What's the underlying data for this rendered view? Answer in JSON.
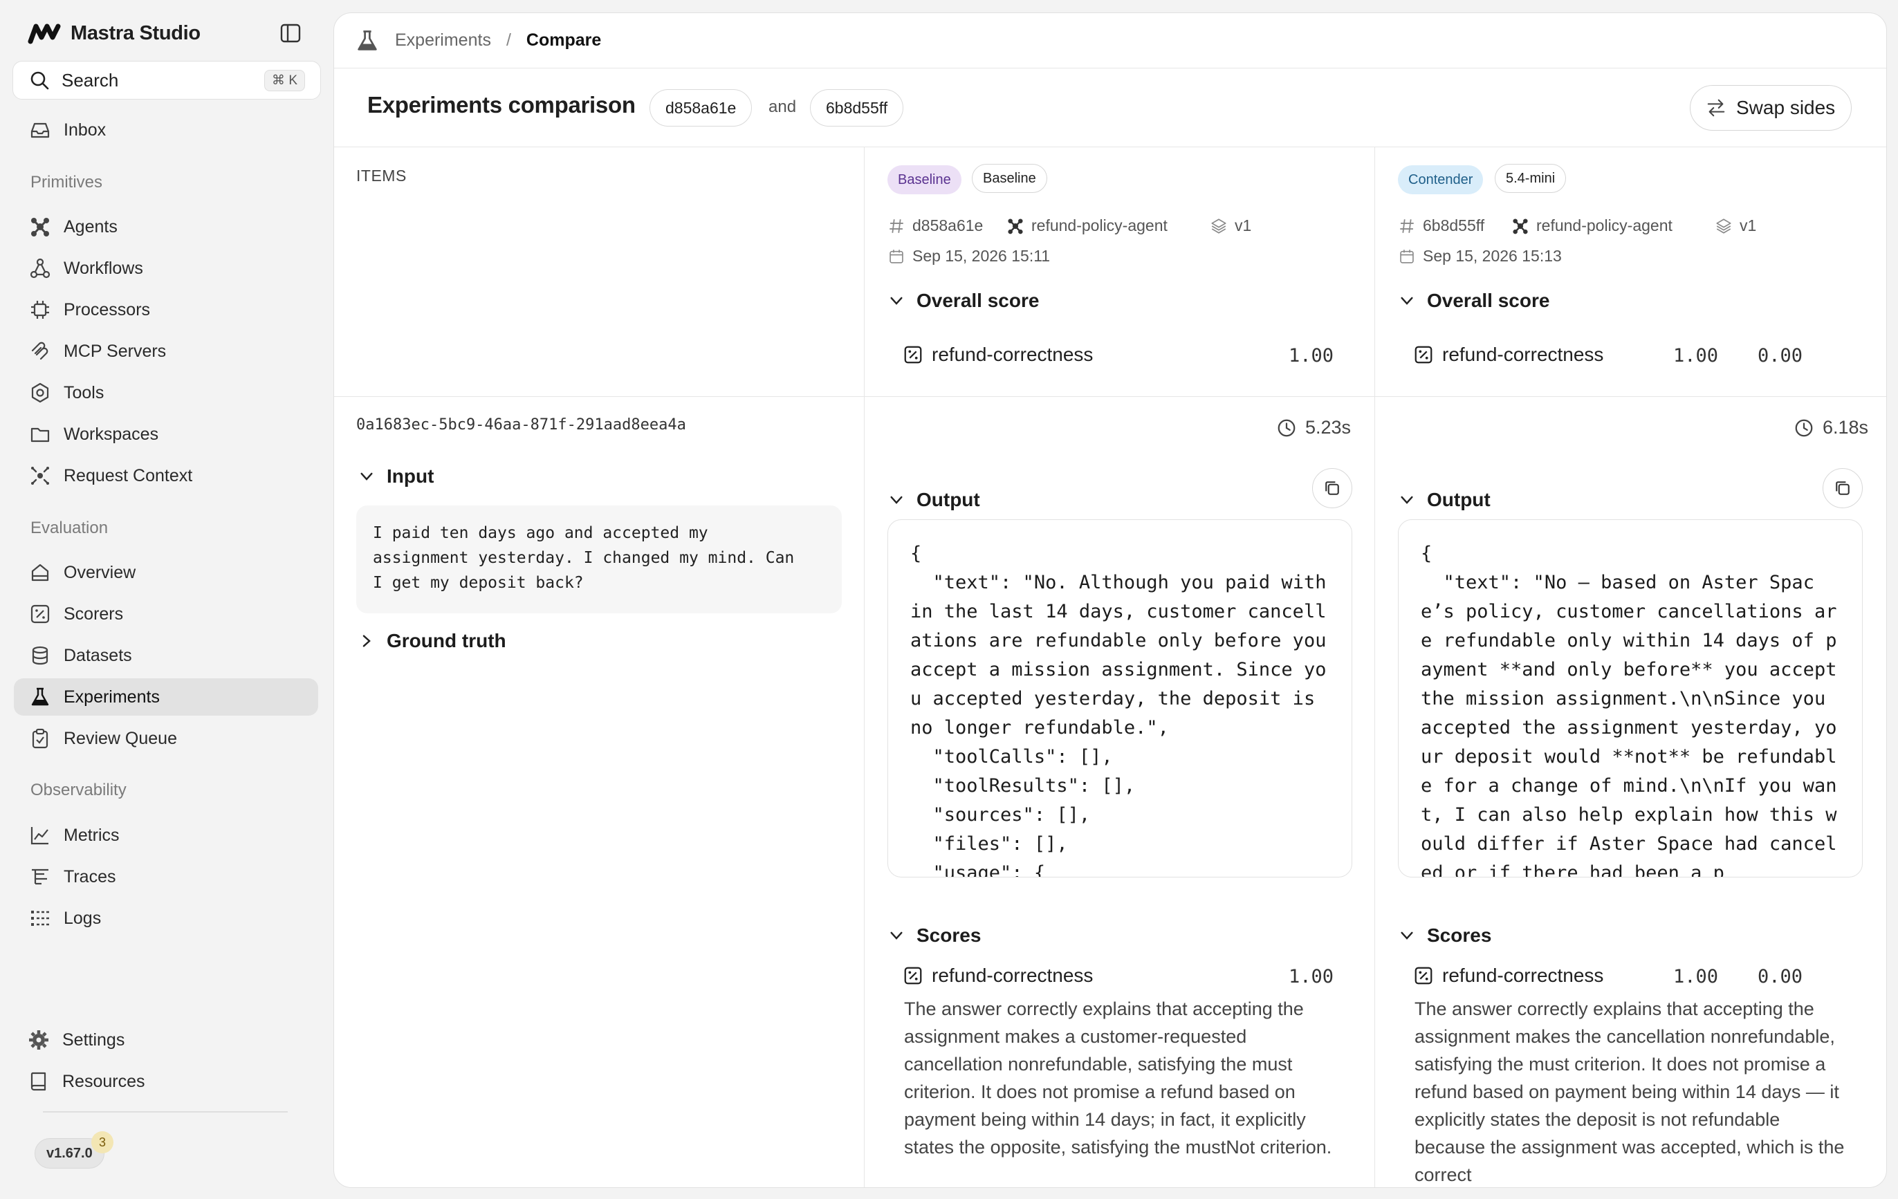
{
  "app": {
    "brand": "Mastra Studio",
    "search_label": "Search",
    "search_shortcut": "⌘ K",
    "version": "v1.67.0",
    "version_badge": "3"
  },
  "sidebar": {
    "top_items": [
      {
        "label": "Inbox",
        "icon": "inbox-icon"
      }
    ],
    "sections": [
      {
        "title": "Primitives",
        "items": [
          {
            "label": "Agents",
            "icon": "agents-icon"
          },
          {
            "label": "Workflows",
            "icon": "workflows-icon"
          },
          {
            "label": "Processors",
            "icon": "processors-icon"
          },
          {
            "label": "MCP Servers",
            "icon": "mcp-icon"
          },
          {
            "label": "Tools",
            "icon": "tools-icon"
          },
          {
            "label": "Workspaces",
            "icon": "folder-icon"
          },
          {
            "label": "Request Context",
            "icon": "request-context-icon"
          }
        ]
      },
      {
        "title": "Evaluation",
        "items": [
          {
            "label": "Overview",
            "icon": "home-icon"
          },
          {
            "label": "Scorers",
            "icon": "percent-icon"
          },
          {
            "label": "Datasets",
            "icon": "database-icon"
          },
          {
            "label": "Experiments",
            "icon": "flask-icon",
            "active": true
          },
          {
            "label": "Review Queue",
            "icon": "clipboard-icon"
          }
        ]
      },
      {
        "title": "Observability",
        "items": [
          {
            "label": "Metrics",
            "icon": "chart-icon"
          },
          {
            "label": "Traces",
            "icon": "traces-icon"
          },
          {
            "label": "Logs",
            "icon": "logs-icon"
          }
        ]
      }
    ],
    "bottom_items": [
      {
        "label": "Settings",
        "icon": "gear-icon"
      },
      {
        "label": "Resources",
        "icon": "book-icon"
      }
    ]
  },
  "breadcrumb": {
    "parent": "Experiments",
    "separator": "/",
    "current": "Compare"
  },
  "header": {
    "title": "Experiments comparison",
    "left_id": "d858a61e",
    "joiner": "and",
    "right_id": "6b8d55ff",
    "swap_label": "Swap sides"
  },
  "items_label": "ITEMS",
  "experiments": {
    "left": {
      "role_badge": "Baseline",
      "name_badge": "Baseline",
      "id": "d858a61e",
      "agent": "refund-policy-agent",
      "version": "v1",
      "date": "Sep 15, 2026 15:11",
      "overall_label": "Overall score",
      "overall_scorer": "refund-correctness",
      "overall_value": "1.00",
      "duration": "5.23s",
      "output_label": "Output",
      "output": "{\n  \"text\": \"No. Although you paid within the last 14 days, customer cancellations are refundable only before you accept a mission assignment. Since you accepted yesterday, the deposit is no longer refundable.\",\n  \"toolCalls\": [],\n  \"toolResults\": [],\n  \"sources\": [],\n  \"files\": [],\n  \"usage\": {",
      "scores_label": "Scores",
      "score_scorer": "refund-correctness",
      "score_value": "1.00",
      "reason": "The answer correctly explains that accepting the assignment makes a customer-requested cancellation nonrefundable, satisfying the must criterion. It does not promise a refund based on payment being within 14 days; in fact, it explicitly states the opposite, satisfying the mustNot criterion."
    },
    "right": {
      "role_badge": "Contender",
      "name_badge": "5.4-mini",
      "id": "6b8d55ff",
      "agent": "refund-policy-agent",
      "version": "v1",
      "date": "Sep 15, 2026 15:13",
      "overall_label": "Overall score",
      "overall_scorer": "refund-correctness",
      "overall_value": "1.00",
      "overall_delta": "0.00",
      "duration": "6.18s",
      "output_label": "Output",
      "output": "{\n  \"text\": \"No — based on Aster Space’s policy, customer cancellations are refundable only within 14 days of payment **and only before** you accept the mission assignment.\\n\\nSince you accepted the assignment yesterday, your deposit would **not** be refundable for a change of mind.\\n\\nIf you want, I can also help explain how this would differ if Aster Space had canceled or if there had been a p",
      "scores_label": "Scores",
      "score_scorer": "refund-correctness",
      "score_value": "1.00",
      "score_delta": "0.00",
      "reason": "The answer correctly explains that accepting the assignment makes the cancellation nonrefundable, satisfying the must criterion. It does not promise a refund based on payment being within 14 days — it explicitly states the deposit is not refundable because the assignment was accepted, which is the correct"
    }
  },
  "item": {
    "id": "0a1683ec-5bc9-46aa-871f-291aad8eea4a",
    "input_label": "Input",
    "input_text": "I paid ten days ago and accepted my\nassignment yesterday. I changed my mind. Can\nI get my deposit back?",
    "ground_truth_label": "Ground truth"
  },
  "colors": {
    "active_nav": "#e2e2e2",
    "baseline_badge": "#ece0f6",
    "contender_badge": "#d9edfa",
    "version_badge": "#f3e6b4"
  }
}
